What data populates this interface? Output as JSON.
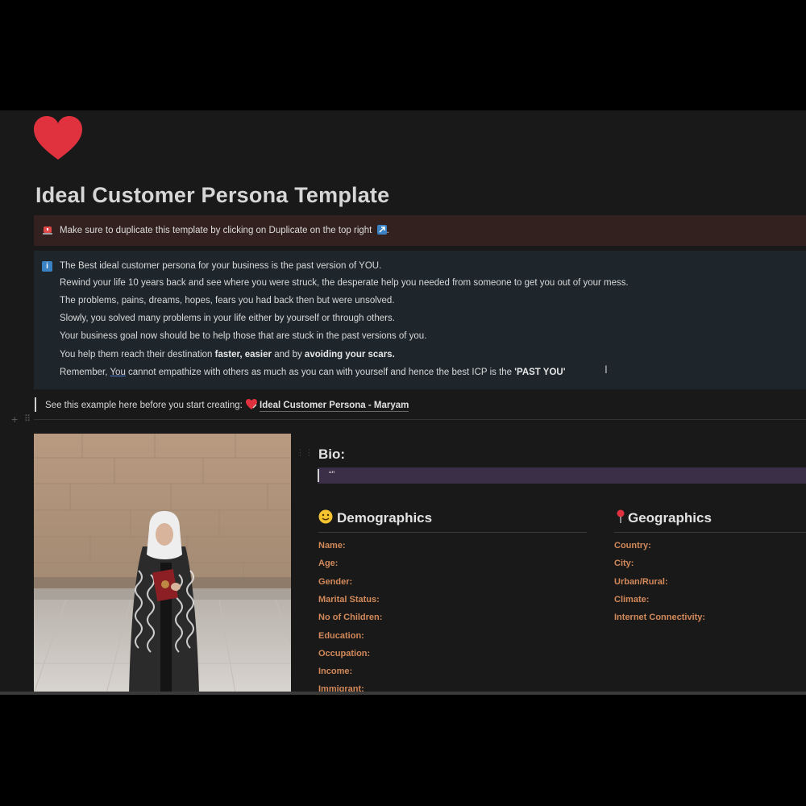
{
  "page": {
    "title": "Ideal Customer Persona Template"
  },
  "callout_red": {
    "text": "Make sure to duplicate this template by clicking on Duplicate on the top right",
    "suffix": "."
  },
  "callout_blue": {
    "line1": "The Best ideal customer persona for your business is the past version of YOU.",
    "line2": "Rewind your life 10 years back and see where you were struck, the desperate help you needed from someone to get you out of your mess.",
    "line3": "The problems, pains, dreams, hopes, fears you had back then but were unsolved.",
    "line4": "Slowly, you solved many problems in your life either by yourself or through others.",
    "line5": "Your business goal now should be to help those that are stuck in the past versions of you.",
    "line6_a": "You help them reach their destination ",
    "line6_b": "faster, easier",
    "line6_c": " and by ",
    "line6_d": "avoiding your scars.",
    "line7_a": "Remember, ",
    "line7_b": "You",
    "line7_c": " cannot empathize with others as much as you can with yourself and hence the best ICP is the ",
    "line7_d": "'PAST YOU'"
  },
  "example": {
    "text": "See this example here before you start creating: ",
    "link": "Ideal Customer Persona - Maryam"
  },
  "bio": {
    "title": "Bio:",
    "value": "“”"
  },
  "demographics": {
    "title": "Demographics",
    "fields": [
      "Name:",
      "Age:",
      "Gender:",
      "Marital Status:",
      "No of Children:",
      "Education:",
      "Occupation:",
      "Income:",
      "Immigrant:"
    ]
  },
  "geographics": {
    "title": "Geographics",
    "fields": [
      "Country:",
      "City:",
      "Urban/Rural:",
      "Climate:",
      "Internet Connectivity:"
    ]
  },
  "icons": {
    "page_icon": "heart-icon",
    "warning": "rotating-light-icon",
    "info": "info-icon",
    "demographics": "smiley-icon",
    "geographics": "pin-icon"
  },
  "colors": {
    "background": "#191919",
    "callout_red_bg": "#33211f",
    "callout_blue_bg": "#1e262c",
    "bio_bg": "#3b2e47",
    "field_label": "#d3895a",
    "heart": "#e0323e"
  }
}
